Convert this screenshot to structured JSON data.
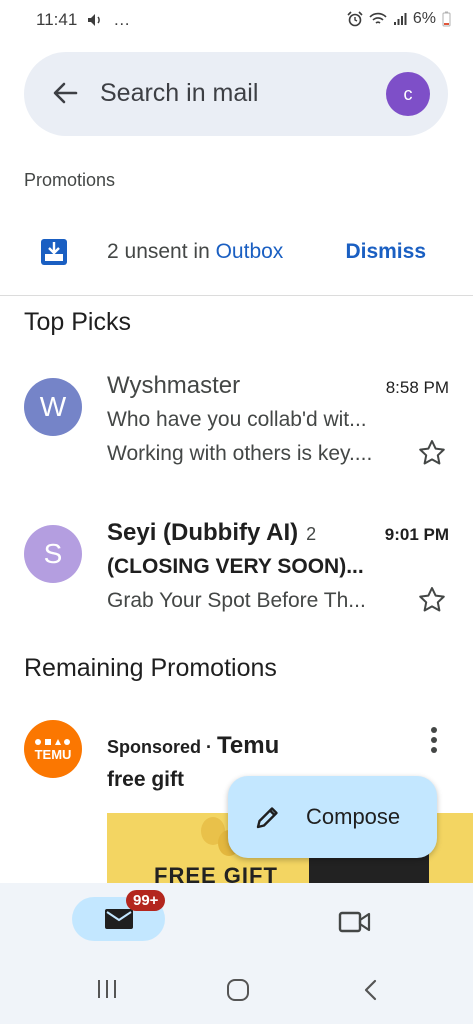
{
  "status": {
    "time": "11:41",
    "battery": "6%",
    "dots": "…"
  },
  "search": {
    "placeholder": "Search in mail",
    "avatar_letter": "c"
  },
  "section_label": "Promotions",
  "outbox": {
    "text": "2 unsent in ",
    "link": "Outbox",
    "dismiss": "Dismiss"
  },
  "groups": {
    "top_picks": "Top Picks",
    "remaining": "Remaining Promotions"
  },
  "emails": [
    {
      "avatar_letter": "W",
      "avatar_color": "#7584c8",
      "sender": "Wyshmaster",
      "count": "",
      "time": "8:58 PM",
      "subject": "Who have you collab'd wit...",
      "snippet": "Working with others is key....",
      "unread": false
    },
    {
      "avatar_letter": "S",
      "avatar_color": "#b49ee0",
      "sender": "Seyi (Dubbify AI)",
      "count": "2",
      "time": "9:01 PM",
      "subject": "(CLOSING VERY SOON)...",
      "snippet": "Grab Your Spot Before Th...",
      "unread": true
    }
  ],
  "ad": {
    "logo_text": "TEMU",
    "sponsored": "Sponsored",
    "separator": " · ",
    "brand": "Temu",
    "subject": "free gift",
    "image_text": "FREE GIFT"
  },
  "compose": {
    "label": "Compose"
  },
  "bottom_nav": {
    "mail_badge": "99+"
  },
  "colors": {
    "accent": "#1a5fc2",
    "compose_bg": "#c3e7ff",
    "badge": "#b3261e",
    "temu": "#fb7701"
  }
}
